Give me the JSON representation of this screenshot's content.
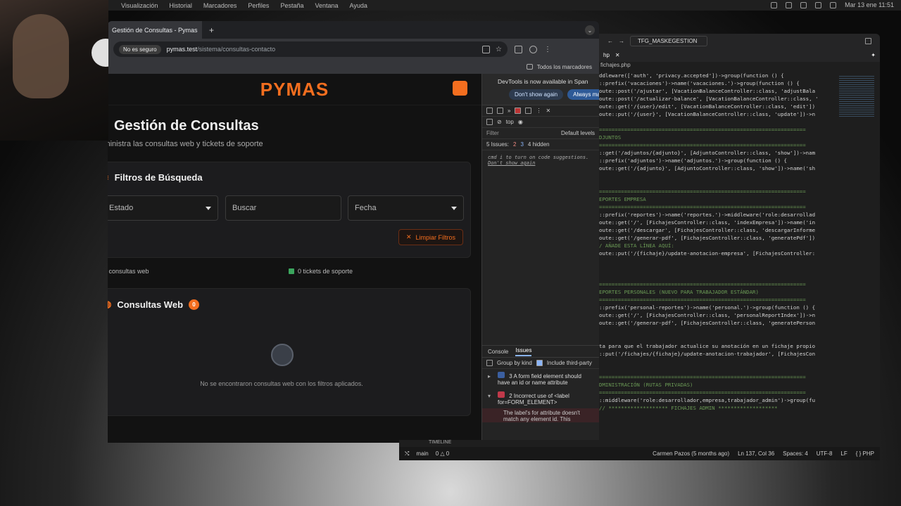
{
  "menubar": {
    "items": [
      "Visualización",
      "Historial",
      "Marcadores",
      "Perfiles",
      "Pestaña",
      "Ventana",
      "Ayuda"
    ],
    "clock": "Mar 13 ene 11:51"
  },
  "browser": {
    "tab_title": "Gestión de Consultas - Pymas",
    "security_badge": "No es seguro",
    "url_host": "pymas.test",
    "url_path": "/sistema/consultas-contacto",
    "bookmarks_label": "Todos los marcadores"
  },
  "app": {
    "logo": "PYMAS",
    "page_title": "Gestión de Consultas",
    "page_subtitle": "Administra las consultas web y tickets de soporte",
    "filters": {
      "title": "Filtros de Búsqueda",
      "estado": "Estado",
      "buscar": "Buscar",
      "fecha": "Fecha",
      "clear_label": "Limpiar Filtros"
    },
    "stats": {
      "web": "0 consultas web",
      "tickets": "0 tickets de soporte"
    },
    "web_card": {
      "title": "Consultas Web",
      "count": "0",
      "empty": "No se encontraron consultas web con los filtros aplicados."
    }
  },
  "devtools": {
    "banner": "DevTools is now available in Span",
    "dont_show": "Don't show again",
    "always": "Always ma",
    "context": "top",
    "filter_placeholder": "Filter",
    "levels": "Default levels",
    "issues_summary": "5 Issues:",
    "err_count": "2",
    "warn_count": "3",
    "hidden": "4 hidden",
    "console_hint_a": "cmd",
    "console_hint_b": "i",
    "console_hint_c": "to turn on code suggestions.",
    "console_hint_d": "Don't show again",
    "bottom_tabs": [
      "Console",
      "Issues"
    ],
    "group_by_kind": "Group by kind",
    "include_third": "Include third-party",
    "issue1": "A form field element should have an id or name attribute",
    "issue1_count": "3",
    "issue2": "Incorrect use of <label for=FORM_ELEMENT>",
    "issue2_count": "2",
    "issue2_detail": "The label's for attribute doesn't match any element id. This"
  },
  "editor": {
    "search": "TFG_MASKEGESTION",
    "tab": "hp",
    "path": "fichajes.php",
    "code_lines": [
      "ddleware(['auth', 'privacy.accepted'])->group(function () {",
      "::prefix('vacaciones')->name('vacaciones.')->group(function () {",
      "oute::post('/ajustar', [VacationBalanceController::class, 'adjustBala",
      "oute::post('/actualizar-balance', [VacationBalanceController::class, '",
      "oute::get('/{user}/edit', [VacationBalanceController::class, 'edit'])",
      "oute::put('/{user}', [VacationBalanceController::class, 'update'])->n",
      "",
      "==================================================================",
      "DJUNTOS",
      "==================================================================",
      "::get('/adjuntos/{adjunto}', [AdjuntoController::class, 'show'])->nam",
      "::prefix('adjuntos')->name('adjuntos.')->group(function () {",
      "oute::get('/{adjunto}', [AdjuntoController::class, 'show'])->name('sh",
      "",
      "",
      "==================================================================",
      "EPORTES EMPRESA",
      "==================================================================",
      "::prefix('reportes')->name('reportes.')->middleware('role:desarrollad",
      "oute::get('/', [FichajesController::class, 'indexEmpresa'])->name('in",
      "oute::get('/descargar', [FichajesController::class, 'descargarInforme",
      "oute::get('/generar-pdf', [FichajesController::class, 'generatePdf'])",
      "/ AÑADE ESTA LÍNEA AQUÍ:",
      "oute::put('/{fichaje}/update-anotacion-empresa', [FichajesController:",
      "",
      "",
      "",
      "==================================================================",
      "EPORTES PERSONALES (NUEVO PARA TRABAJADOR ESTÁNDAR)",
      "==================================================================",
      "::prefix('personal-reportes')->name('personal.')->group(function () {",
      "oute::get('/', [FichajesController::class, 'personalReportIndex'])->n",
      "oute::get('/generar-pdf', [FichajesController::class, 'generatePerson",
      "",
      "",
      "ta para que el trabajador actualice su anotación en un fichaje propio",
      "::put('/fichajes/{fichaje}/update-anotacion-trabajador', [FichajesCon",
      "",
      "",
      "==================================================================",
      "DMINISTRACIÓN (RUTAS PRIVADAS)",
      "==================================================================",
      "::middleware('role:desarrollador,empresa,trabajador_admin')->group(fu",
      "// ******************* FICHAJES ADMIN *******************"
    ],
    "timeline": "TIMELINE",
    "status": {
      "branch": "main",
      "problems": "0 △ 0",
      "blame": "Carmen Pazos (5 months ago)",
      "position": "Ln 137, Col 36",
      "spaces": "Spaces: 4",
      "encoding": "UTF-8",
      "eol": "LF",
      "lang": "{ } PHP"
    }
  }
}
